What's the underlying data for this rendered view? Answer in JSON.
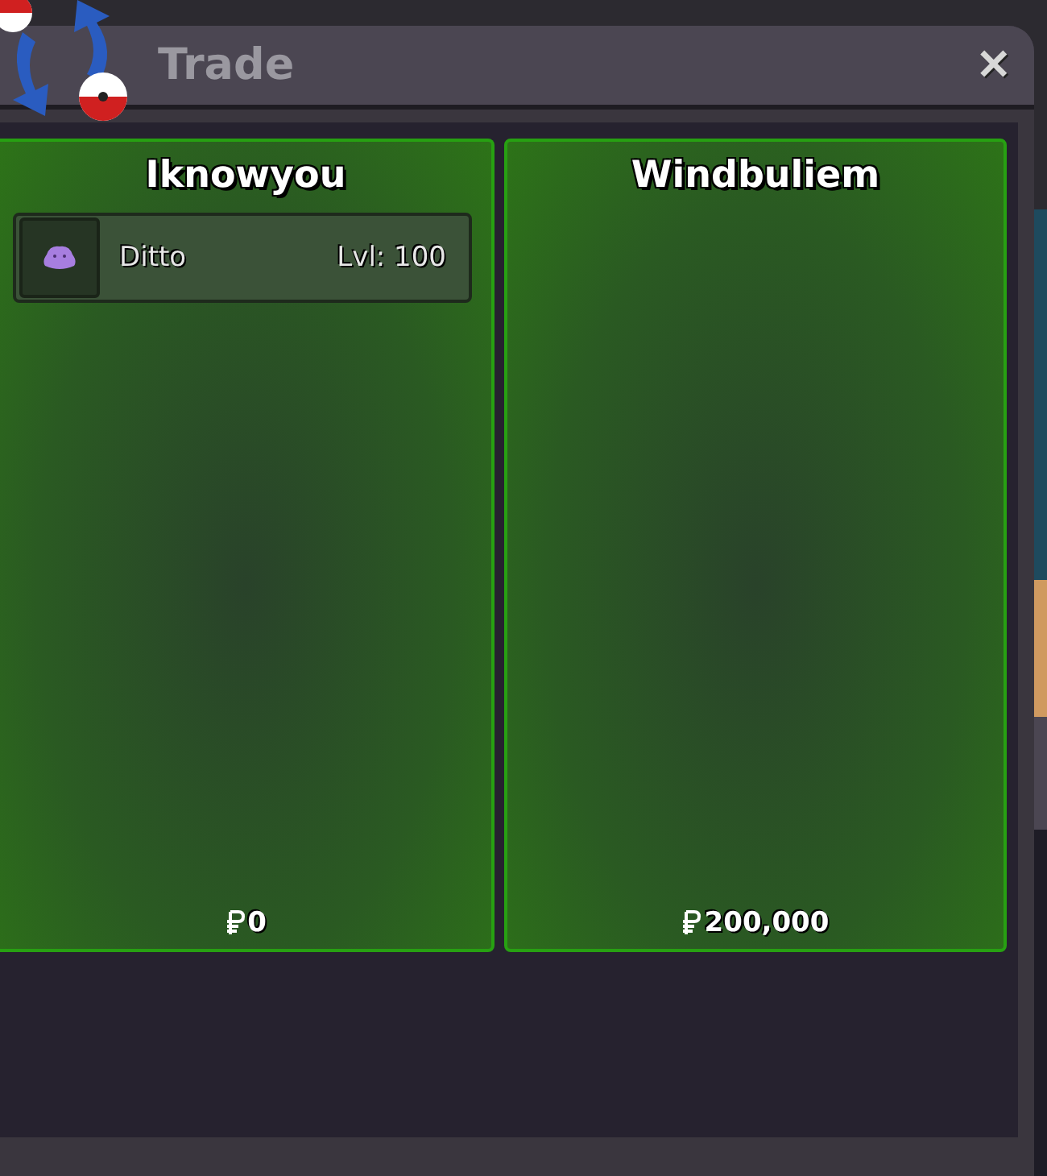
{
  "window": {
    "title": "Trade",
    "close": "✕"
  },
  "panels": [
    {
      "player": "Iknowyou",
      "money": "0",
      "pokemon": [
        {
          "name": "Ditto",
          "level": "Lvl: 100"
        }
      ]
    },
    {
      "player": "Windbuliem",
      "money": "200,000"
    }
  ]
}
